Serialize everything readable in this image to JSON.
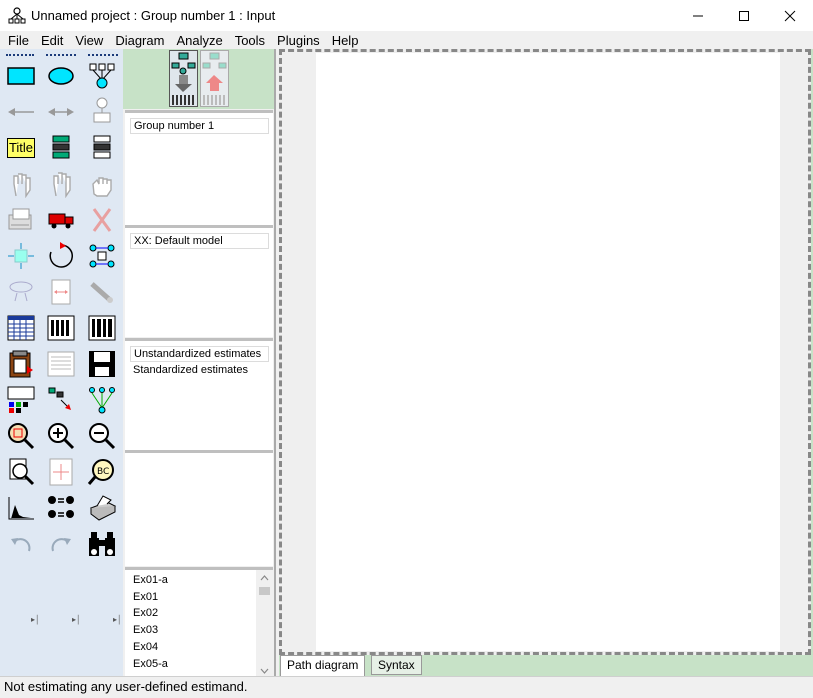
{
  "window": {
    "title": "Unnamed project : Group number 1 : Input"
  },
  "menu": [
    "File",
    "Edit",
    "View",
    "Diagram",
    "Analyze",
    "Tools",
    "Plugins",
    "Help"
  ],
  "toolbox": {
    "tools": [
      "rectangle-icon",
      "ellipse-icon",
      "indicator-tree-icon",
      "single-arrow-icon",
      "double-arrow-icon",
      "unique-variable-icon",
      "title-icon",
      "list-variables-model-icon",
      "list-variables-dataset-icon",
      "select-one-hand-icon",
      "select-all-hand-icon",
      "deselect-hand-icon",
      "copy-object-icon",
      "move-truck-icon",
      "erase-icon",
      "resize-icon",
      "rotate-icon",
      "reflect-icon",
      "shape-change-icon",
      "touch-up-icon",
      "preserve-symmetry-icon",
      "data-files-icon",
      "analysis-properties-icon",
      "calculate-estimates-icon",
      "clipboard-copy-icon",
      "view-text-icon",
      "save-icon",
      "object-properties-icon",
      "drag-properties-icon",
      "move-parameters-icon",
      "zoom-area-icon",
      "zoom-in-icon",
      "zoom-out-icon",
      "view-page-icon",
      "fit-to-page-icon",
      "loupe-icon",
      "distribution-icon",
      "multiple-group-icon",
      "print-icon",
      "undo-icon",
      "redo-icon",
      "specification-search-icon"
    ],
    "title_tool_text": "Title"
  },
  "panels": {
    "groups": {
      "header": "Group number 1"
    },
    "models": {
      "header": "XX: Default model"
    },
    "estimates": {
      "header": "Unstandardized estimates",
      "second": "Standardized estimates"
    }
  },
  "files": [
    "Ex01-a",
    "Ex01",
    "Ex02",
    "Ex03",
    "Ex04",
    "Ex05-a"
  ],
  "tabs": {
    "path_diagram": "Path diagram",
    "syntax": "Syntax"
  },
  "status": "Not estimating any user-defined estimand.",
  "colors": {
    "toolbox_bg": "#dfe8f3",
    "green_panel": "#c7e2c7",
    "cyan_shape": "#00e5ff",
    "accent": "#0040ff"
  }
}
